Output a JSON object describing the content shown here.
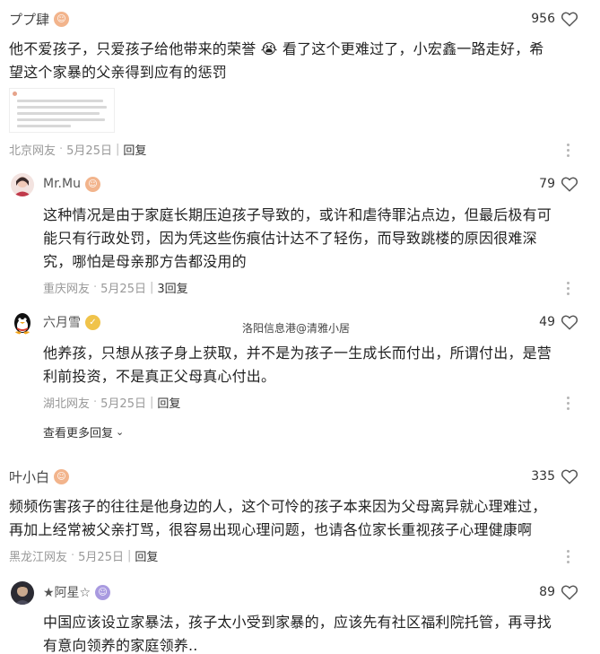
{
  "comments": [
    {
      "name": "ププ肆",
      "likes": "956",
      "text": "他不爱孩子，只爱孩子给他带来的荣誉 😭 看了这个更难过了，小宏鑫一路走好，希望这个家暴的父亲得到应有的惩罚",
      "line1": "他不爱孩子，只爱孩子给他带来的荣誉 😭 看了这个更难过了，小宏鑫一路走好，希",
      "line2": "望这个家暴的父亲得到应有的惩罚",
      "location": "北京网友",
      "date": "5月25日",
      "reply": "回复"
    },
    {
      "name": "Mr.Mu",
      "likes": "79",
      "line1": "这种情况是由于家庭长期压迫孩子导致的，或许和虐待罪沾点边，但最后极有可",
      "line2": "能只有行政处罚，因为凭这些伤痕估计达不了轻伤，而导致跳楼的原因很难深",
      "line3": "究，哪怕是母亲那方告都没用的",
      "location": "重庆网友",
      "date": "5月25日",
      "reply": "3回复"
    },
    {
      "name": "六月雪",
      "likes": "49",
      "line1": "他养孩，只想从孩子身上获取，并不是为孩子一生成长而付出，所谓付出，是营",
      "line2": "利前投资，不是真正父母真心付出。",
      "location": "湖北网友",
      "date": "5月25日",
      "reply": "回复"
    },
    {
      "name": "叶小白",
      "likes": "335",
      "line1": "频频伤害孩子的往往是他身边的人，这个可怜的孩子本来因为父母离异就心理难过，",
      "line2": "再加上经常被父亲打骂，很容易出现心理问题，也请各位家长重视孩子心理健康啊",
      "location": "黑龙江网友",
      "date": "5月25日",
      "reply": "回复"
    },
    {
      "name": "★阿星☆",
      "likes": "89",
      "line1": "中国应该设立家暴法，孩子太小受到家暴的，应该先有社区福利院托管，再寻找",
      "line2": "有意向领养的家庭领养..",
      "location": "",
      "date": "",
      "reply": ""
    }
  ],
  "watermark": "洛阳信息港@清雅小居",
  "see_more": "查看更多回复",
  "icons": [
    "heart-outline-icon",
    "more-vertical-icon",
    "chevron-down-icon"
  ],
  "colors": {
    "text": "#222222",
    "meta": "#999999",
    "icon": "#555555"
  }
}
